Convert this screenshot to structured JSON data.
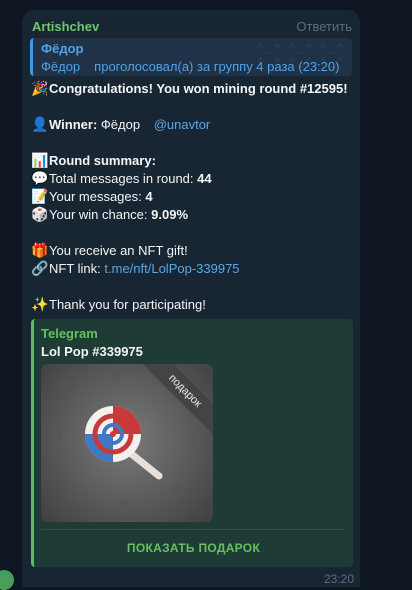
{
  "message": {
    "sender": "Artishchev",
    "reply_label": "Ответить",
    "time": "23:20",
    "quote": {
      "name": "Фёдор",
      "text_name": "Фёдор",
      "text_action": "проголосовал(а) за группу 4 раза (23:20)"
    },
    "lines": {
      "congrats": "Congratulations! You won mining round #12595!",
      "winner_label": "Winner:",
      "winner_name": "Фёдор",
      "winner_handle": "@unavtor",
      "summary_label": "Round summary:",
      "total_label": "Total messages in round:",
      "total_value": "44",
      "yours_label": "Your messages:",
      "yours_value": "4",
      "chance_label": "Your win chance:",
      "chance_value": "9.09%",
      "gift_text": "You receive an NFT gift!",
      "nft_label": "NFT link:",
      "nft_url": "t.me/nft/LolPop-339975",
      "thanks": "Thank you for participating!"
    },
    "emoji": {
      "party": "🎉",
      "person": "👤",
      "chart": "📊",
      "speech": "💬",
      "memo": "📝",
      "dice": "🎲",
      "gift": "🎁",
      "link": "🔗",
      "sparkles": "✨"
    },
    "card": {
      "site": "Telegram",
      "title": "Lol Pop #339975",
      "ribbon": "подарок",
      "button": "ПОКАЗАТЬ ПОДАРОК"
    }
  },
  "colors": {
    "background": "#0e1621",
    "bubble": "#182533",
    "sender": "#6ec86b",
    "link": "#5aa7e8",
    "card_accent": "#5cbf5b"
  }
}
